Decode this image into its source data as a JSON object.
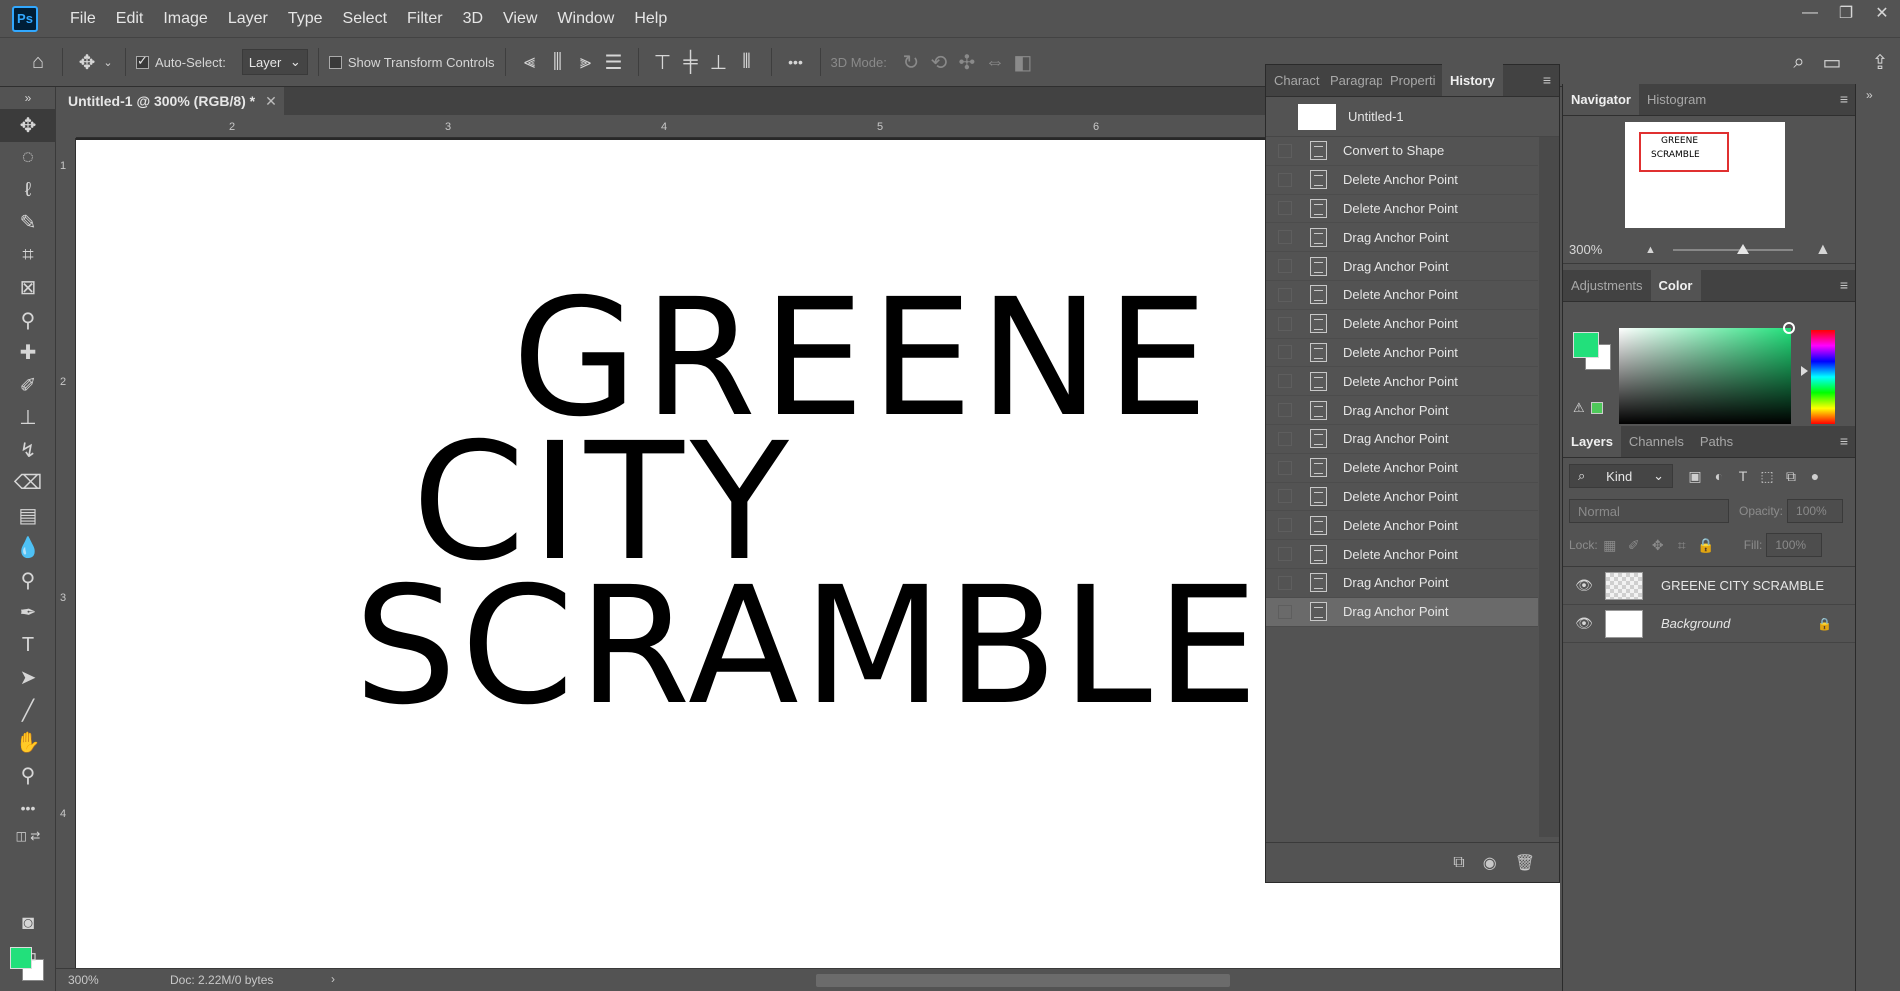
{
  "app": {
    "logo": "Ps"
  },
  "menu": [
    "File",
    "Edit",
    "Image",
    "Layer",
    "Type",
    "Select",
    "Filter",
    "3D",
    "View",
    "Window",
    "Help"
  ],
  "window_controls": {
    "minimize": "—",
    "maximize": "❐",
    "close": "✕"
  },
  "options": {
    "auto_select_label": "Auto-Select:",
    "auto_select_checked": true,
    "auto_select_target": "Layer",
    "show_transform_label": "Show Transform Controls",
    "mode_3d_label": "3D Mode:",
    "more_label": "•••"
  },
  "document": {
    "tab_title": "Untitled-1 @ 300% (RGB/8) *",
    "tab_close": "✕",
    "canvas_lines": [
      "GREENE",
      "CITY",
      "SCRAMBLE"
    ]
  },
  "rulers": {
    "h_numbers": [
      "2",
      "3",
      "4",
      "5",
      "6"
    ],
    "v_numbers": [
      "1",
      "2",
      "3",
      "4"
    ]
  },
  "status": {
    "zoom": "300%",
    "doc_info": "Doc: 2.22M/0 bytes",
    "arrow": "›"
  },
  "history_panel": {
    "tabs": [
      "Charact",
      "Paragrap",
      "Properti",
      "History"
    ],
    "active_tab": "History",
    "snapshot": "Untitled-1",
    "states": [
      "Convert to Shape",
      "Delete Anchor Point",
      "Delete Anchor Point",
      "Drag Anchor Point",
      "Drag Anchor Point",
      "Delete Anchor Point",
      "Delete Anchor Point",
      "Delete Anchor Point",
      "Delete Anchor Point",
      "Drag Anchor Point",
      "Drag Anchor Point",
      "Delete Anchor Point",
      "Delete Anchor Point",
      "Delete Anchor Point",
      "Delete Anchor Point",
      "Drag Anchor Point",
      "Drag Anchor Point"
    ],
    "selected_index": 16
  },
  "navigator": {
    "tabs": [
      "Navigator",
      "Histogram"
    ],
    "zoom": "300%",
    "preview_lines": [
      "GREENE",
      "SCRAMBLE"
    ]
  },
  "color_panel": {
    "tabs": [
      "Adjustments",
      "Color"
    ],
    "active_tab": "Color",
    "foreground": "#22e07b",
    "background": "#ffffff"
  },
  "layers_panel": {
    "tabs": [
      "Layers",
      "Channels",
      "Paths"
    ],
    "filter_kind": "Kind",
    "blend_mode": "Normal",
    "opacity_label": "Opacity:",
    "opacity_value": "100%",
    "lock_label": "Lock:",
    "fill_label": "Fill:",
    "fill_value": "100%",
    "layers": [
      {
        "name": "GREENE  CITY SCRAMBLE",
        "type": "shape",
        "visible": true
      },
      {
        "name": "Background",
        "type": "background",
        "visible": true
      }
    ]
  }
}
